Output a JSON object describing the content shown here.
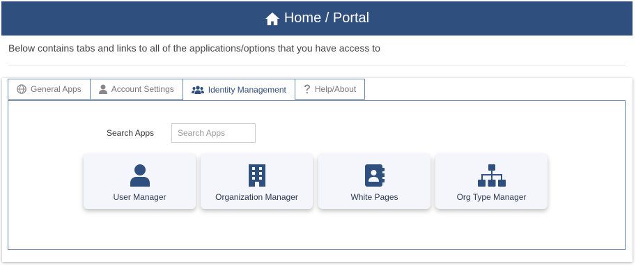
{
  "header": {
    "title": "Home / Portal",
    "icon": "home-icon"
  },
  "subtitle": "Below contains tabs and links to all of the applications/options that you have access to",
  "tabs": [
    {
      "label": "General Apps",
      "icon": "globe-icon",
      "active": false
    },
    {
      "label": "Account Settings",
      "icon": "user-icon",
      "active": false
    },
    {
      "label": "Identity Management",
      "icon": "users-icon",
      "active": true
    },
    {
      "label": "Help/About",
      "icon": "question-icon",
      "active": false
    }
  ],
  "search": {
    "label": "Search Apps",
    "placeholder": "Search Apps",
    "value": ""
  },
  "apps": [
    {
      "label": "User Manager",
      "icon": "user-icon"
    },
    {
      "label": "Organization Manager",
      "icon": "building-icon"
    },
    {
      "label": "White Pages",
      "icon": "address-book-icon"
    },
    {
      "label": "Org Type Manager",
      "icon": "sitemap-icon"
    }
  ],
  "colors": {
    "header_bg": "#2f4f7f",
    "accent": "#2f4f7f",
    "icon_color": "#2f4f7f",
    "card_bg": "#f5f6fb"
  }
}
